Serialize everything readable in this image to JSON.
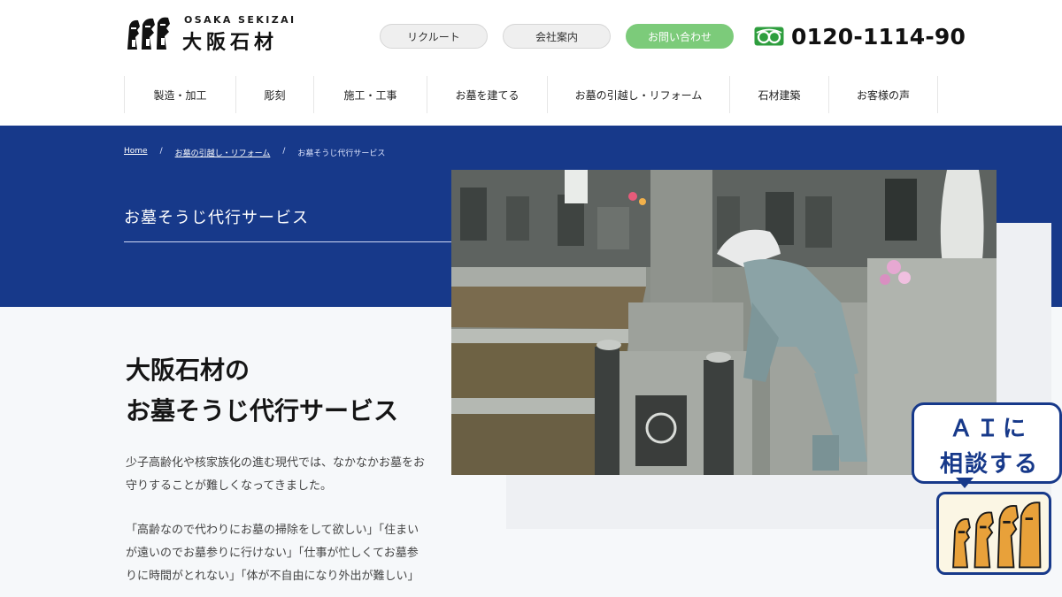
{
  "header": {
    "logo_latin": "OSAKA SEKIZAI",
    "logo_kanji": "大阪石材",
    "buttons": [
      {
        "label": "リクルート"
      },
      {
        "label": "会社案内"
      },
      {
        "label": "お問い合わせ"
      }
    ],
    "phone": "0120-1114-90"
  },
  "nav": {
    "items": [
      {
        "label": "製造・加工"
      },
      {
        "label": "彫刻"
      },
      {
        "label": "施工・工事"
      },
      {
        "label": "お墓を建てる"
      },
      {
        "label": "お墓の引越し・リフォーム"
      },
      {
        "label": "石材建築"
      },
      {
        "label": "お客様の声"
      }
    ]
  },
  "breadcrumb": {
    "home": "Home",
    "sep": "/",
    "parent": "お墓の引越し・リフォーム",
    "current": "お墓そうじ代行サービス"
  },
  "hero": {
    "title": "お墓そうじ代行サービス"
  },
  "content": {
    "heading_line1": "大阪石材の",
    "heading_line2": "お墓そうじ代行サービス",
    "para1_line1": "少子高齢化や核家族化の進む現代では、なかなかお墓をお",
    "para1_line2": "守りすることが難しくなってきました。",
    "para2_line1": "「高齢なので代わりにお墓の掃除をして欲しい」「住まい",
    "para2_line2": "が遠いのでお墓参りに行けない」「仕事が忙しくてお墓参",
    "para2_line3": "りに時間がとれない」「体が不自由になり外出が難しい」"
  },
  "ai_widget": {
    "line1": "ＡＩに",
    "line2": "相談する"
  },
  "colors": {
    "brand_navy": "#17398a",
    "contact_green": "#7ccb7a",
    "ai_badge_orange": "#e8a13a"
  },
  "icons": {
    "phone": "freedial-icon",
    "logo": "moai-logo-icon",
    "ai": "moai-ai-icon"
  }
}
